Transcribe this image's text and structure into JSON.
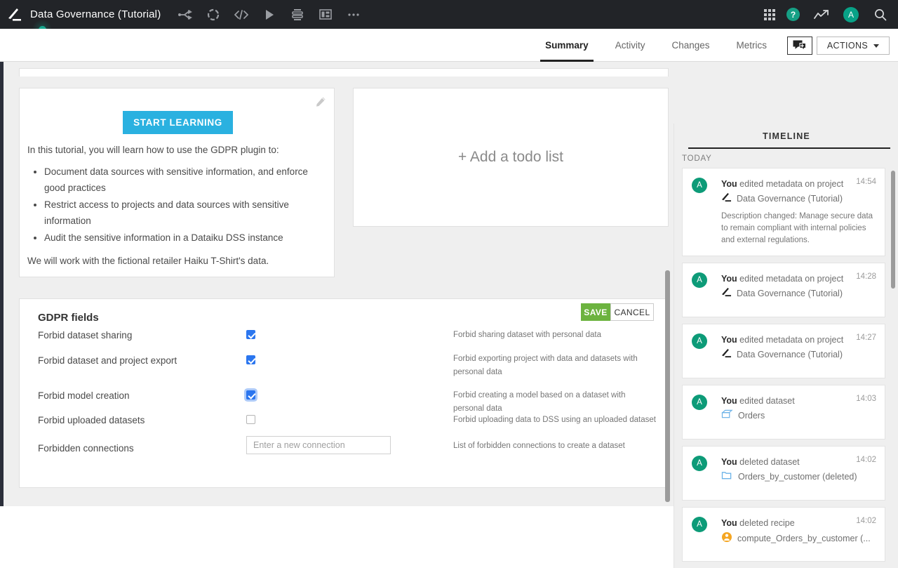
{
  "topbar": {
    "logo_name": "dataiku-logo-icon",
    "project_title": "Data Governance (Tutorial)",
    "nav_icons": [
      "flow-icon",
      "dataset-circle-icon",
      "code-icon",
      "run-icon",
      "jobs-icon",
      "dashboard-icon",
      "more-icon"
    ],
    "right_icons": [
      "apps-grid-icon",
      "help-icon",
      "insights-icon",
      "user-avatar",
      "search-icon"
    ],
    "help_glyph": "?",
    "avatar_initial": "A",
    "bg_color": "#222428"
  },
  "tabbar": {
    "tabs": [
      {
        "label": "Summary",
        "active": true
      },
      {
        "label": "Activity",
        "active": false
      },
      {
        "label": "Changes",
        "active": false
      },
      {
        "label": "Metrics",
        "active": false
      }
    ],
    "chat_icon": "add-discussion-icon",
    "actions_label": "ACTIONS"
  },
  "tutorial_card": {
    "edit_icon": "pencil-icon",
    "start_button": "START LEARNING",
    "intro": "In this tutorial, you will learn how to use the GDPR plugin to:",
    "bullets": [
      "Document data sources with sensitive information, and enforce good practices",
      "Restrict access to projects and data sources with sensitive information",
      "Audit the sensitive information in a Dataiku DSS instance"
    ],
    "closing": "We will work with the fictional retailer Haiku T-Shirt's data."
  },
  "todo_card": {
    "empty_label": "+ Add a todo list"
  },
  "gdpr": {
    "title": "GDPR fields",
    "save_label": "SAVE",
    "cancel_label": "CANCEL",
    "save_color": "#6cb33f",
    "fields": [
      {
        "label": "Forbid dataset sharing",
        "type": "checkbox",
        "checked": true,
        "focused": false,
        "description": "Forbid sharing dataset with personal data"
      },
      {
        "label": "Forbid dataset and project export",
        "type": "checkbox",
        "checked": true,
        "focused": false,
        "description": "Forbid exporting project with data and datasets with personal data"
      },
      {
        "label": "Forbid model creation",
        "type": "checkbox",
        "checked": true,
        "focused": true,
        "description": "Forbid creating a model based on a dataset with personal data"
      },
      {
        "label": "Forbid uploaded datasets",
        "type": "checkbox",
        "checked": false,
        "focused": false,
        "description": "Forbid uploading data to DSS using an uploaded dataset"
      },
      {
        "label": "Forbidden connections",
        "type": "text",
        "value": "",
        "placeholder": "Enter a new connection",
        "description": "List of forbidden connections to create a dataset"
      }
    ]
  },
  "timeline": {
    "header": "TIMELINE",
    "group_label": "TODAY",
    "avatar_initial": "A",
    "items": [
      {
        "actor": "You",
        "action": "edited metadata on project",
        "time": "14:54",
        "object_icon": "project-icon",
        "object": "Data Governance (Tutorial)",
        "detail": "Description changed: Manage secure data to remain compliant with internal policies and external regulations."
      },
      {
        "actor": "You",
        "action": "edited metadata on project",
        "time": "14:28",
        "object_icon": "project-icon",
        "object": "Data Governance (Tutorial)",
        "detail": ""
      },
      {
        "actor": "You",
        "action": "edited metadata on project",
        "time": "14:27",
        "object_icon": "project-icon",
        "object": "Data Governance (Tutorial)",
        "detail": ""
      },
      {
        "actor": "You",
        "action": "edited dataset",
        "time": "14:03",
        "object_icon": "dataset-icon",
        "object": "Orders",
        "detail": ""
      },
      {
        "actor": "You",
        "action": "deleted dataset",
        "time": "14:02",
        "object_icon": "dataset-deleted-icon",
        "object": "Orders_by_customer (deleted)",
        "detail": ""
      },
      {
        "actor": "You",
        "action": "deleted recipe",
        "time": "14:02",
        "object_icon": "recipe-icon",
        "object": "compute_Orders_by_customer (...",
        "detail": ""
      }
    ]
  }
}
